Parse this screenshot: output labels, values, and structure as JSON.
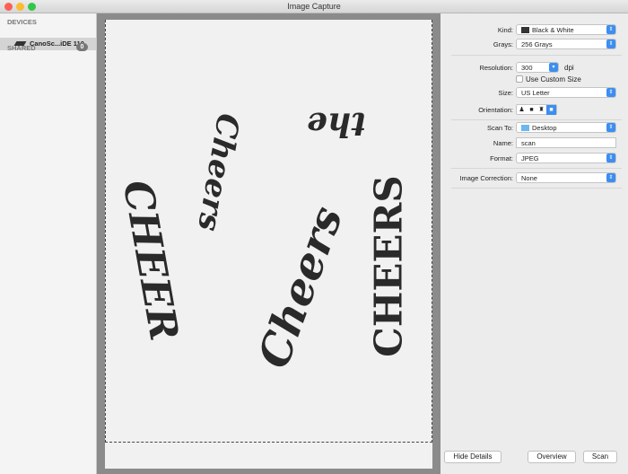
{
  "window": {
    "title": "Image Capture"
  },
  "sidebar": {
    "devices_header": "DEVICES",
    "device_name": "CanoSc...iDE 110",
    "shared_header": "SHARED",
    "shared_count": "0"
  },
  "preview": {
    "lettering": [
      "CHEER",
      "Cheers",
      "Cheers",
      "the",
      "CHEERS"
    ]
  },
  "settings": {
    "kind_label": "Kind:",
    "kind_value": "Black & White",
    "grays_label": "Grays:",
    "grays_value": "256 Grays",
    "resolution_label": "Resolution:",
    "resolution_value": "300",
    "resolution_unit": "dpi",
    "custom_size_label": "Use Custom Size",
    "custom_size_checked": false,
    "size_label": "Size:",
    "size_value": "US Letter",
    "orientation_label": "Orientation:",
    "orientation_selected": 4,
    "scan_to_label": "Scan To:",
    "scan_to_value": "Desktop",
    "name_label": "Name:",
    "name_value": "scan",
    "format_label": "Format:",
    "format_value": "JPEG",
    "correction_label": "Image Correction:",
    "correction_value": "None"
  },
  "buttons": {
    "hide_details": "Hide Details",
    "overview": "Overview",
    "scan": "Scan"
  },
  "colors": {
    "accent": "#3d8ef0",
    "close": "#fc5f57",
    "minimize": "#fdbc2e",
    "zoom": "#33c748"
  }
}
